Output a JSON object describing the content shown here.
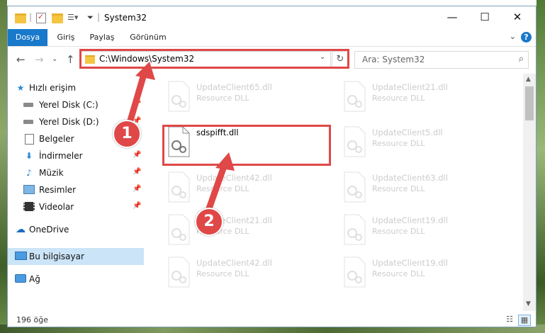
{
  "window": {
    "title": "System32",
    "controls": {
      "minimize": "—",
      "maximize": "☐",
      "close": "✕"
    }
  },
  "ribbon": {
    "tabs": [
      "Dosya",
      "Giriş",
      "Paylaş",
      "Görünüm"
    ],
    "help": "?"
  },
  "nav": {
    "address": "C:\\Windows\\System32",
    "search_placeholder": "Ara: System32"
  },
  "sidebar": {
    "items": [
      {
        "label": "Hızlı erişim",
        "icon": "star-icon"
      },
      {
        "label": "Yerel Disk (C:)",
        "icon": "drive-icon",
        "pinned": true
      },
      {
        "label": "Yerel Disk (D:)",
        "icon": "drive-icon",
        "pinned": true
      },
      {
        "label": "Belgeler",
        "icon": "documents-icon",
        "pinned": true
      },
      {
        "label": "İndirmeler",
        "icon": "download-icon",
        "pinned": true
      },
      {
        "label": "Müzik",
        "icon": "music-icon",
        "pinned": true
      },
      {
        "label": "Resimler",
        "icon": "pictures-icon",
        "pinned": true
      },
      {
        "label": "Videolar",
        "icon": "videos-icon",
        "pinned": true
      },
      {
        "label": "OneDrive",
        "icon": "cloud-icon"
      },
      {
        "label": "Bu bilgisayar",
        "icon": "computer-icon",
        "selected": true
      },
      {
        "label": "Ağ",
        "icon": "network-icon"
      }
    ]
  },
  "files": {
    "left": [
      {
        "name": "UpdateClient65.dll",
        "type": "Resource DLL",
        "faded": true
      },
      {
        "name": "sdspifft.dll",
        "type": "",
        "faded": false
      },
      {
        "name": "UpdateClient42.dll",
        "type": "Resource DLL",
        "faded": true
      },
      {
        "name": "UpdateClient21.dll",
        "type": "Resource DLL",
        "faded": true
      },
      {
        "name": "UpdateClient42.dll",
        "type": "Resource DLL",
        "faded": true
      }
    ],
    "right": [
      {
        "name": "UpdateClient21.dll",
        "type": "Resource DLL",
        "faded": true
      },
      {
        "name": "UpdateClient5.dll",
        "type": "Resource DLL",
        "faded": true
      },
      {
        "name": "UpdateClient63.dll",
        "type": "Resource DLL",
        "faded": true
      },
      {
        "name": "UpdateClient19.dll",
        "type": "Resource DLL",
        "faded": true
      },
      {
        "name": "UpdateClient19.dll",
        "type": "Resource DLL",
        "faded": true
      }
    ]
  },
  "status": {
    "item_count": "196 öğe"
  },
  "annotations": {
    "step1": "1",
    "step2": "2"
  },
  "colors": {
    "accent": "#1979ca",
    "highlight": "#e04848",
    "selected": "#cce4f7"
  }
}
